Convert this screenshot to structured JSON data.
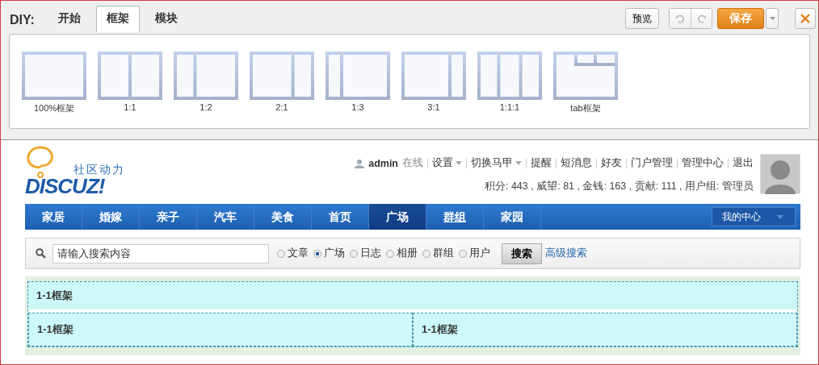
{
  "diy_bar": {
    "title": "DIY:",
    "tabs": [
      {
        "label": "开始",
        "selected": false
      },
      {
        "label": "框架",
        "selected": true
      },
      {
        "label": "模块",
        "selected": false
      }
    ],
    "preview_button": "预览",
    "undo_disabled": true,
    "redo_disabled": true,
    "save_button": "保存"
  },
  "frame_palette": [
    {
      "label": "100%框架",
      "kind": "single"
    },
    {
      "label": "1:1",
      "kind": "halves"
    },
    {
      "label": "1:2",
      "kind": "narrowleft"
    },
    {
      "label": "2:1",
      "kind": "narrowright"
    },
    {
      "label": "1:3",
      "kind": "quarterleft"
    },
    {
      "label": "3:1",
      "kind": "quarterright"
    },
    {
      "label": "1:1:1",
      "kind": "thirds"
    },
    {
      "label": "tab框架",
      "kind": "tabbed"
    }
  ],
  "site": {
    "logo_tagline": "社区动力",
    "logo_text": "DISCUZ!",
    "user": "admin",
    "user_status": "在线",
    "top_links": [
      {
        "label": "设置",
        "dropdown": true
      },
      {
        "label": "切换马甲",
        "dropdown": true
      },
      {
        "label": "提醒",
        "dropdown": false
      },
      {
        "label": "短消息",
        "dropdown": false
      },
      {
        "label": "好友",
        "dropdown": false
      },
      {
        "label": "门户管理",
        "dropdown": false
      },
      {
        "label": "管理中心",
        "dropdown": false
      },
      {
        "label": "退出",
        "dropdown": false
      }
    ],
    "stats": "积分: 443 , 威望: 81 , 金钱: 163 , 贡献: 111 , 用户组: 管理员",
    "nav": [
      {
        "label": "家居",
        "selected": false,
        "underlined": false
      },
      {
        "label": "婚嫁",
        "selected": false,
        "underlined": false
      },
      {
        "label": "亲子",
        "selected": false,
        "underlined": false
      },
      {
        "label": "汽车",
        "selected": false,
        "underlined": false
      },
      {
        "label": "美食",
        "selected": false,
        "underlined": false
      },
      {
        "label": "首页",
        "selected": false,
        "underlined": false
      },
      {
        "label": "广场",
        "selected": true,
        "underlined": false
      },
      {
        "label": "群组",
        "selected": false,
        "underlined": true
      },
      {
        "label": "家园",
        "selected": false,
        "underlined": false
      }
    ],
    "my_center": "我的中心",
    "search": {
      "placeholder": "请输入搜索内容",
      "options": [
        {
          "label": "文章",
          "selected": false
        },
        {
          "label": "广场",
          "selected": true
        },
        {
          "label": "日志",
          "selected": false
        },
        {
          "label": "相册",
          "selected": false
        },
        {
          "label": "群组",
          "selected": false
        },
        {
          "label": "用户",
          "selected": false
        }
      ],
      "button": "搜索",
      "advanced_link": "高级搜索"
    },
    "frame": {
      "title": "1-1框架",
      "columns": [
        {
          "title": "1-1框架"
        },
        {
          "title": "1-1框架"
        }
      ]
    }
  }
}
